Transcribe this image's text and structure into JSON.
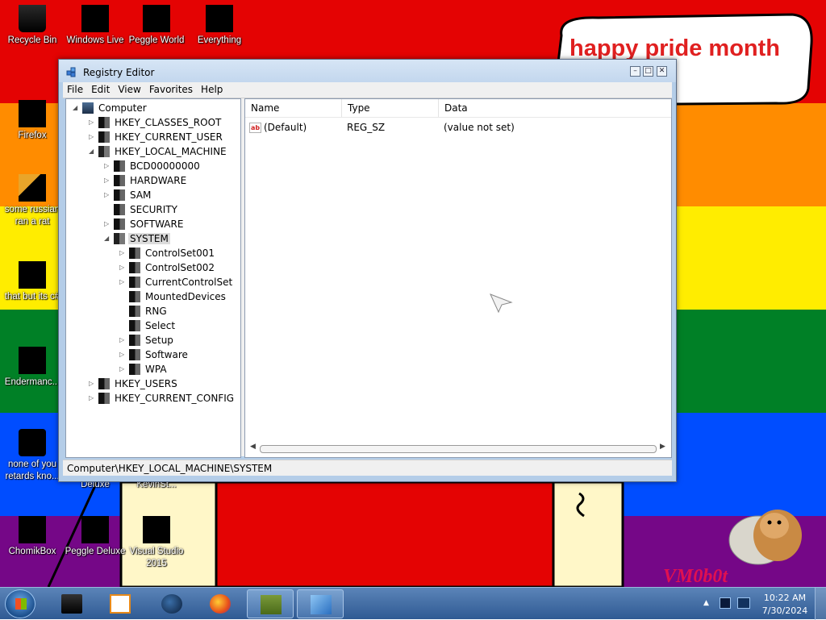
{
  "desktop": {
    "icons": [
      {
        "label": "Recycle Bin"
      },
      {
        "label": "Windows Live"
      },
      {
        "label": "Peggle World"
      },
      {
        "label": "Everything"
      },
      {
        "label": "Firefox"
      },
      {
        "label": "some russian ran a rat"
      },
      {
        "label": "that but its c#"
      },
      {
        "label": "Endermanc..."
      },
      {
        "label": "none of you retards kno..."
      },
      {
        "label": "ChomikBox"
      },
      {
        "label": "Peggle Deluxe"
      },
      {
        "label": "Visual Studio 2015"
      }
    ],
    "partial_labels": {
      "deluxe": "Deluxe",
      "kevinst": "KevinSt..."
    },
    "wallpaper_text": "happy pride month",
    "watermark_text": "VM0b0t",
    "colors": {
      "red": "#e40303",
      "orange": "#ff8c00",
      "yellow": "#ffed00",
      "green": "#008026",
      "blue": "#004dff",
      "purple": "#750787"
    }
  },
  "window": {
    "title": "Registry Editor",
    "menu": [
      "File",
      "Edit",
      "View",
      "Favorites",
      "Help"
    ],
    "tree": {
      "root": "Computer",
      "hives": [
        {
          "label": "HKEY_CLASSES_ROOT",
          "state": "collapsed"
        },
        {
          "label": "HKEY_CURRENT_USER",
          "state": "collapsed"
        },
        {
          "label": "HKEY_LOCAL_MACHINE",
          "state": "expanded"
        },
        {
          "label": "HKEY_USERS",
          "state": "collapsed"
        },
        {
          "label": "HKEY_CURRENT_CONFIG",
          "state": "collapsed"
        }
      ],
      "hklm_children": [
        "BCD00000000",
        "HARDWARE",
        "SAM",
        "SECURITY",
        "SOFTWARE",
        "SYSTEM"
      ],
      "system_children": [
        "ControlSet001",
        "ControlSet002",
        "CurrentControlSet",
        "MountedDevices",
        "RNG",
        "Select",
        "Setup",
        "Software",
        "WPA"
      ],
      "selected": "SYSTEM"
    },
    "columns": {
      "name": "Name",
      "type": "Type",
      "data": "Data"
    },
    "values": [
      {
        "name": "(Default)",
        "type": "REG_SZ",
        "data": "(value not set)"
      }
    ],
    "status_path": "Computer\\HKEY_LOCAL_MACHINE\\SYSTEM"
  },
  "taskbar": {
    "time": "10:22 AM",
    "date": "7/30/2024",
    "buttons": [
      "cmd-box-icon",
      "media-player-icon",
      "globe-icon",
      "firefox-icon",
      "chomikbox-icon",
      "registry-editor-icon"
    ]
  }
}
